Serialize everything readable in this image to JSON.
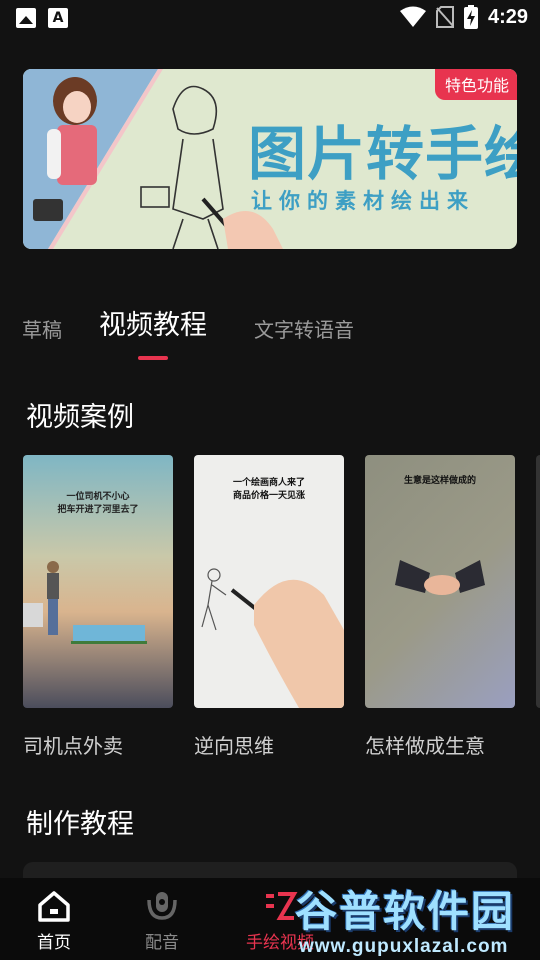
{
  "status_bar": {
    "time": "4:29"
  },
  "banner": {
    "badge": "特色功能",
    "title": "图片转手绘",
    "subtitle": "让你的素材绘出来",
    "accent_color": "#3d9fc4",
    "badge_color": "#e8344f"
  },
  "tabs": [
    {
      "label": "草稿"
    },
    {
      "label": "视频教程"
    },
    {
      "label": "文字转语音"
    }
  ],
  "sections": {
    "cases_title": "视频案例",
    "tutorial_title": "制作教程"
  },
  "cases": [
    {
      "label": "司机点外卖",
      "caption1": "一位司机不小心",
      "caption2": "把车开进了河里去了"
    },
    {
      "label": "逆向思维",
      "caption1": "一个绘画商人来了",
      "caption2": "商品价格一天见涨"
    },
    {
      "label": "怎样做成生意",
      "caption1": "生意是这样做成的",
      "caption2": ""
    }
  ],
  "bottom_nav": [
    {
      "label": "首页",
      "icon": "home-icon"
    },
    {
      "label": "配音",
      "icon": "microphone-icon"
    },
    {
      "label": "手绘视频",
      "icon": "hand-drawn-video-icon"
    }
  ],
  "watermark": {
    "text": "谷普软件园",
    "url": "www.gupuxlazal.com"
  }
}
